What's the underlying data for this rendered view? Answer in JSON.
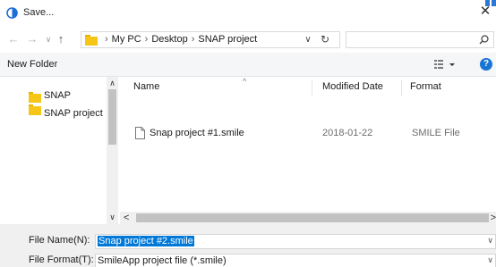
{
  "window": {
    "title": "Save..."
  },
  "address": {
    "crumbs": [
      "My PC",
      "Desktop",
      "SNAP project"
    ],
    "separator": "›",
    "search_placeholder": ""
  },
  "toolbar": {
    "new_folder_label": "New Folder",
    "help_label": "?"
  },
  "nav_pane": {
    "items": [
      {
        "label": "SNAP"
      },
      {
        "label": "SNAP project"
      }
    ]
  },
  "file_list": {
    "columns": [
      "Name",
      "Modified Date",
      "Format"
    ],
    "rows": [
      {
        "name": "Snap project #1.smile",
        "modified": "2018-01-22",
        "format": "SMILE File"
      }
    ]
  },
  "fields": {
    "file_name_label": "File Name(N):",
    "file_name_value": "Snap project #2.smile",
    "file_format_label": "File Format(T):",
    "file_format_value": "SmileApp project file (*.smile)"
  },
  "colors": {
    "accent": "#0078d7",
    "folder": "#f5c518",
    "help": "#1a74d4"
  }
}
